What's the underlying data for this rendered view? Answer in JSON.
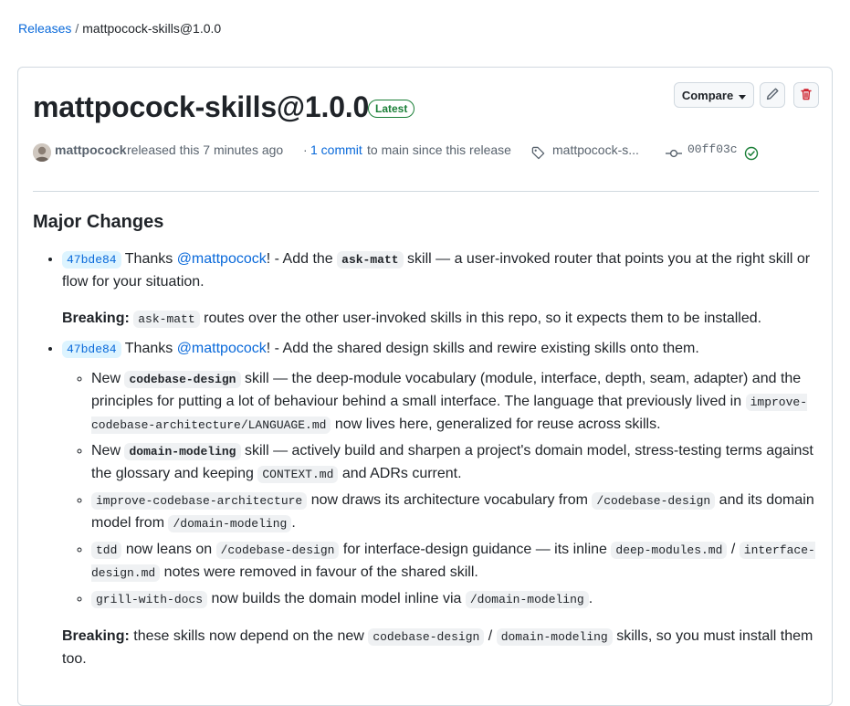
{
  "breadcrumb": {
    "releases": "Releases",
    "separator": "/",
    "current": "mattpocock-skills@1.0.0"
  },
  "release": {
    "title": "mattpocock-skills@1.0.0",
    "badge": "Latest",
    "compare_label": "Compare",
    "author": "mattpocock",
    "released_text": "released this 7 minutes ago",
    "dot": "·",
    "commit_link": "1 commit",
    "commit_suffix": "to main since this release",
    "tag": "mattpocock-s...",
    "sha": "00ff03c"
  },
  "notes": {
    "heading": "Major Changes",
    "item1": {
      "sha": "47bde84",
      "thanks": "Thanks",
      "mention": "@mattpocock",
      "t1": "! - Add the",
      "code1": "ask-matt",
      "t2": "skill — a user-invoked router that points you at the right skill or flow for your situation.",
      "breaking_label": "Breaking:",
      "bcode": "ask-matt",
      "btext": "routes over the other user-invoked skills in this repo, so it expects them to be installed."
    },
    "item2": {
      "sha": "47bde84",
      "thanks": "Thanks",
      "mention": "@mattpocock",
      "t1": "! - Add the shared design skills and rewire existing skills onto them.",
      "sub1": {
        "t0": "New",
        "code1": "codebase-design",
        "t1": "skill — the deep-module vocabulary (module, interface, depth, seam, adapter) and the principles for putting a lot of behaviour behind a small interface. The language that previously lived in",
        "code2": "improve-codebase-architecture/LANGUAGE.md",
        "t2": "now lives here, generalized for reuse across skills."
      },
      "sub2": {
        "t0": "New",
        "code1": "domain-modeling",
        "t1": "skill — actively build and sharpen a project's domain model, stress-testing terms against the glossary and keeping",
        "code2": "CONTEXT.md",
        "t2": "and ADRs current."
      },
      "sub3": {
        "code1": "improve-codebase-architecture",
        "t1": "now draws its architecture vocabulary from",
        "code2": "/codebase-design",
        "t2": "and its domain model from",
        "code3": "/domain-modeling",
        "t3": "."
      },
      "sub4": {
        "code1": "tdd",
        "t1": "now leans on",
        "code2": "/codebase-design",
        "t2": "for interface-design guidance — its inline",
        "code3": "deep-modules.md",
        "t3": "/",
        "code4": "interface-design.md",
        "t4": "notes were removed in favour of the shared skill."
      },
      "sub5": {
        "code1": "grill-with-docs",
        "t1": "now builds the domain model inline via",
        "code2": "/domain-modeling",
        "t2": "."
      },
      "breaking_label": "Breaking:",
      "b1": "these skills now depend on the new",
      "bcode1": "codebase-design",
      "b2": "/",
      "bcode2": "domain-modeling",
      "b3": "skills, so you must install them too."
    }
  },
  "colors": {
    "link": "#0969da",
    "latest": "#1a7f37",
    "danger": "#cf222e",
    "border": "#d1d9e0"
  }
}
